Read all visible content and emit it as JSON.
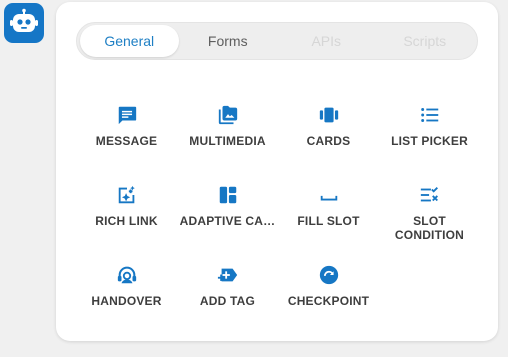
{
  "tabs": [
    {
      "label": "General",
      "state": "active"
    },
    {
      "label": "Forms",
      "state": "normal"
    },
    {
      "label": "APIs",
      "state": "disabled"
    },
    {
      "label": "Scripts",
      "state": "disabled"
    }
  ],
  "items": [
    {
      "label": "MESSAGE",
      "icon": "message-icon"
    },
    {
      "label": "MULTIMEDIA",
      "icon": "multimedia-icon"
    },
    {
      "label": "CARDS",
      "icon": "cards-icon"
    },
    {
      "label": "LIST PICKER",
      "icon": "list-picker-icon"
    },
    {
      "label": "RICH LINK",
      "icon": "rich-link-icon"
    },
    {
      "label": "ADAPTIVE CA…",
      "icon": "adaptive-card-icon"
    },
    {
      "label": "FILL SLOT",
      "icon": "fill-slot-icon"
    },
    {
      "label": "SLOT CONDITION",
      "icon": "slot-condition-icon"
    },
    {
      "label": "HANDOVER",
      "icon": "handover-icon"
    },
    {
      "label": "ADD TAG",
      "icon": "add-tag-icon"
    },
    {
      "label": "CHECKPOINT",
      "icon": "checkpoint-icon"
    }
  ],
  "colors": {
    "accent": "#1576c6",
    "icon": "#1677c4",
    "label": "#3e3e3e",
    "tab_active": "#1e7fc4"
  }
}
